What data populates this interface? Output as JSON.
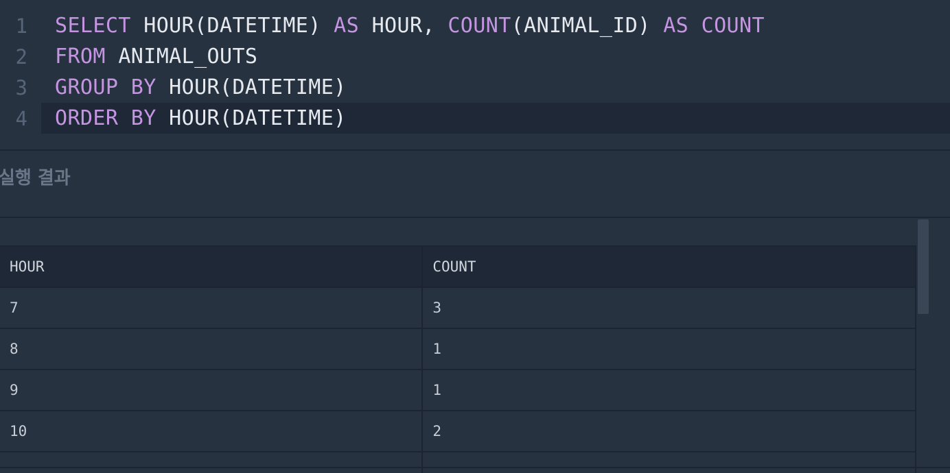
{
  "editor": {
    "lines": [
      {
        "number": "1",
        "tokens": [
          {
            "text": "SELECT",
            "kind": "kw"
          },
          {
            "text": " HOUR(DATETIME) ",
            "kind": "plain"
          },
          {
            "text": "AS",
            "kind": "kw"
          },
          {
            "text": " HOUR, ",
            "kind": "plain"
          },
          {
            "text": "COUNT",
            "kind": "kw"
          },
          {
            "text": "(ANIMAL_ID) ",
            "kind": "plain"
          },
          {
            "text": "AS",
            "kind": "kw"
          },
          {
            "text": " ",
            "kind": "plain"
          },
          {
            "text": "COUNT",
            "kind": "kw"
          }
        ]
      },
      {
        "number": "2",
        "tokens": [
          {
            "text": "FROM",
            "kind": "kw"
          },
          {
            "text": " ANIMAL_OUTS",
            "kind": "plain"
          }
        ]
      },
      {
        "number": "3",
        "tokens": [
          {
            "text": "GROUP BY",
            "kind": "kw"
          },
          {
            "text": " HOUR(DATETIME)",
            "kind": "plain"
          }
        ]
      },
      {
        "number": "4",
        "active": true,
        "tokens": [
          {
            "text": "ORDER BY",
            "kind": "kw"
          },
          {
            "text": " HOUR(DATETIME)",
            "kind": "plain"
          }
        ]
      }
    ],
    "colors": {
      "keyword": "#c595e2",
      "text": "#e6e9ee",
      "line_number": "#56657a",
      "background": "#263240",
      "active_line": "#1e2837"
    }
  },
  "results": {
    "title": "실행 결과",
    "columns": [
      "HOUR",
      "COUNT"
    ],
    "rows": [
      [
        "7",
        "3"
      ],
      [
        "8",
        "1"
      ],
      [
        "9",
        "1"
      ],
      [
        "10",
        "2"
      ],
      [
        "",
        ""
      ]
    ]
  }
}
